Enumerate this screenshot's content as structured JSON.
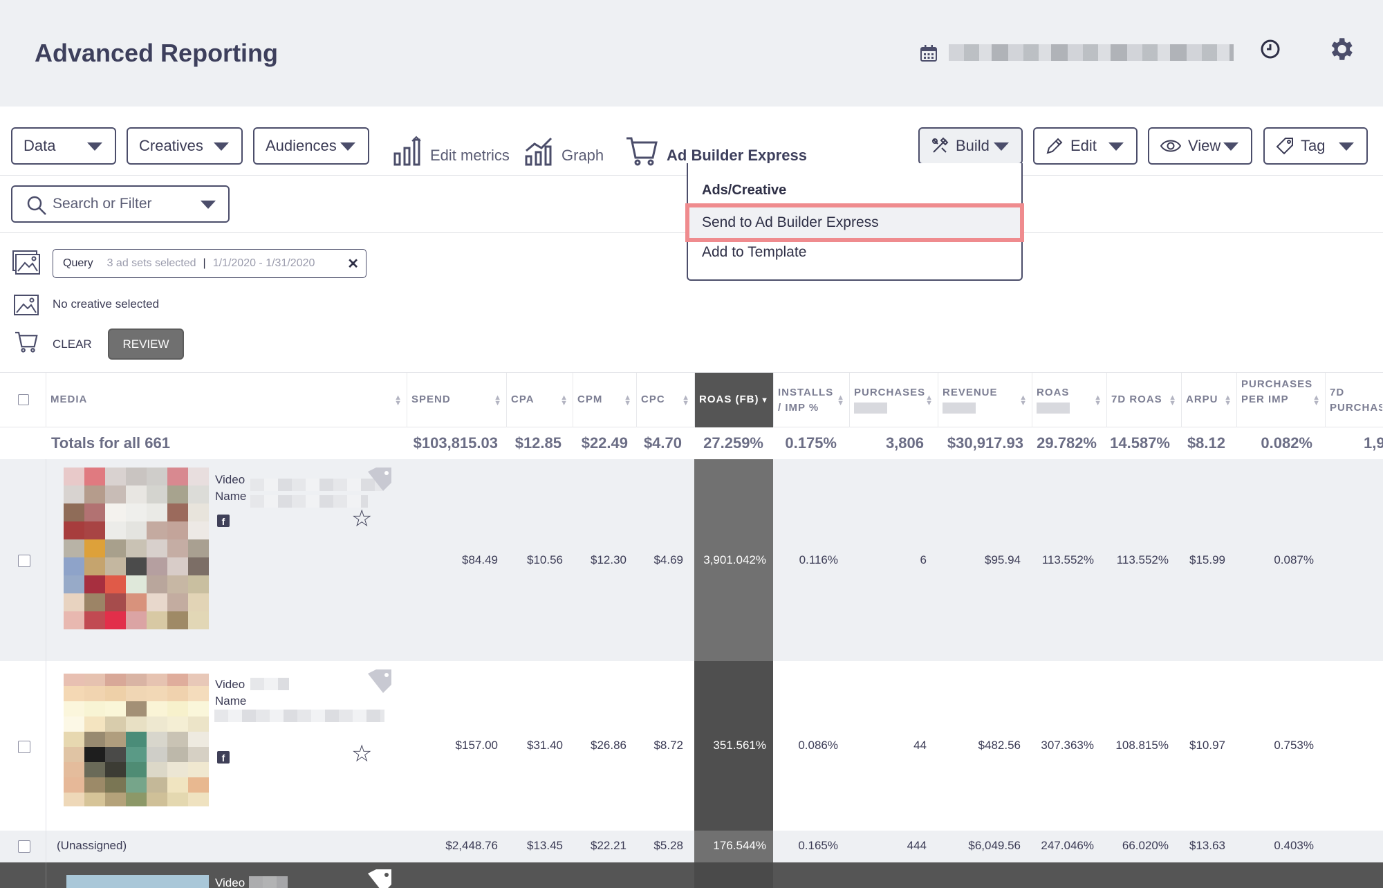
{
  "header": {
    "title": "Advanced Reporting"
  },
  "toolbar": {
    "data_label": "Data",
    "creatives_label": "Creatives",
    "audiences_label": "Audiences",
    "edit_metrics_label": "Edit metrics",
    "graph_label": "Graph",
    "ad_builder_label": "Ad Builder Express",
    "build_label": "Build",
    "edit_label": "Edit",
    "view_label": "View",
    "tag_label": "Tag"
  },
  "search": {
    "placeholder": "Search or Filter"
  },
  "build_menu": {
    "heading": "Ads/Creative",
    "items": [
      "Send to Ad Builder Express",
      "Add to Template"
    ]
  },
  "query": {
    "label": "Query",
    "selection": "3 ad sets selected",
    "date_range": "1/1/2020 - 1/31/2020"
  },
  "creative_status": "No creative selected",
  "cart": {
    "clear_label": "CLEAR",
    "review_label": "REVIEW"
  },
  "table": {
    "columns": [
      {
        "id": "media",
        "label": "MEDIA"
      },
      {
        "id": "spend",
        "label": "SPEND"
      },
      {
        "id": "cpa",
        "label": "CPA"
      },
      {
        "id": "cpm",
        "label": "CPM"
      },
      {
        "id": "cpc",
        "label": "CPC"
      },
      {
        "id": "roas_fb",
        "label": "ROAS (FB)"
      },
      {
        "id": "installs",
        "label": "INSTALLS / IMP %"
      },
      {
        "id": "purchases",
        "label": "PURCHASES"
      },
      {
        "id": "revenue",
        "label": "REVENUE"
      },
      {
        "id": "roas",
        "label": "ROAS"
      },
      {
        "id": "roas_7d",
        "label": "7D ROAS"
      },
      {
        "id": "arpu",
        "label": "ARPU"
      },
      {
        "id": "purchases_per_imp",
        "label": "PURCHASES PER IMP"
      },
      {
        "id": "purchases_7d",
        "label": "7D PURCHAS"
      }
    ],
    "totals": {
      "label": "Totals for all 661",
      "spend": "$103,815.03",
      "cpa": "$12.85",
      "cpm": "$22.49",
      "cpc": "$4.70",
      "roas_fb": "27.259%",
      "installs": "0.175%",
      "purchases": "3,806",
      "revenue": "$30,917.93",
      "roas": "29.782%",
      "roas_7d": "14.587%",
      "arpu": "$8.12",
      "purchases_per_imp": "0.082%",
      "purchases_7d": "1,9"
    },
    "rows": [
      {
        "media_type": "Video",
        "media_name": "Name",
        "spend": "$84.49",
        "cpa": "$10.56",
        "cpm": "$12.30",
        "cpc": "$4.69",
        "roas_fb": "3,901.042%",
        "installs": "0.116%",
        "purchases": "6",
        "revenue": "$95.94",
        "roas": "113.552%",
        "roas_7d": "113.552%",
        "arpu": "$15.99",
        "purchases_per_imp": "0.087%"
      },
      {
        "media_type": "Video",
        "media_name": "Name",
        "spend": "$157.00",
        "cpa": "$31.40",
        "cpm": "$26.86",
        "cpc": "$8.72",
        "roas_fb": "351.561%",
        "installs": "0.086%",
        "purchases": "44",
        "revenue": "$482.56",
        "roas": "307.363%",
        "roas_7d": "108.815%",
        "arpu": "$10.97",
        "purchases_per_imp": "0.753%"
      },
      {
        "media_name": "(Unassigned)",
        "spend": "$2,448.76",
        "cpa": "$13.45",
        "cpm": "$22.21",
        "cpc": "$5.28",
        "roas_fb": "176.544%",
        "installs": "0.165%",
        "purchases": "444",
        "revenue": "$6,049.56",
        "roas": "247.046%",
        "roas_7d": "66.020%",
        "arpu": "$13.63",
        "purchases_per_imp": "0.403%"
      },
      {
        "media_type": "Video"
      }
    ]
  },
  "colors": {
    "accent": "#4b4d6a",
    "highlight_border": "#ef8b8e",
    "roas_column": "#555555"
  }
}
